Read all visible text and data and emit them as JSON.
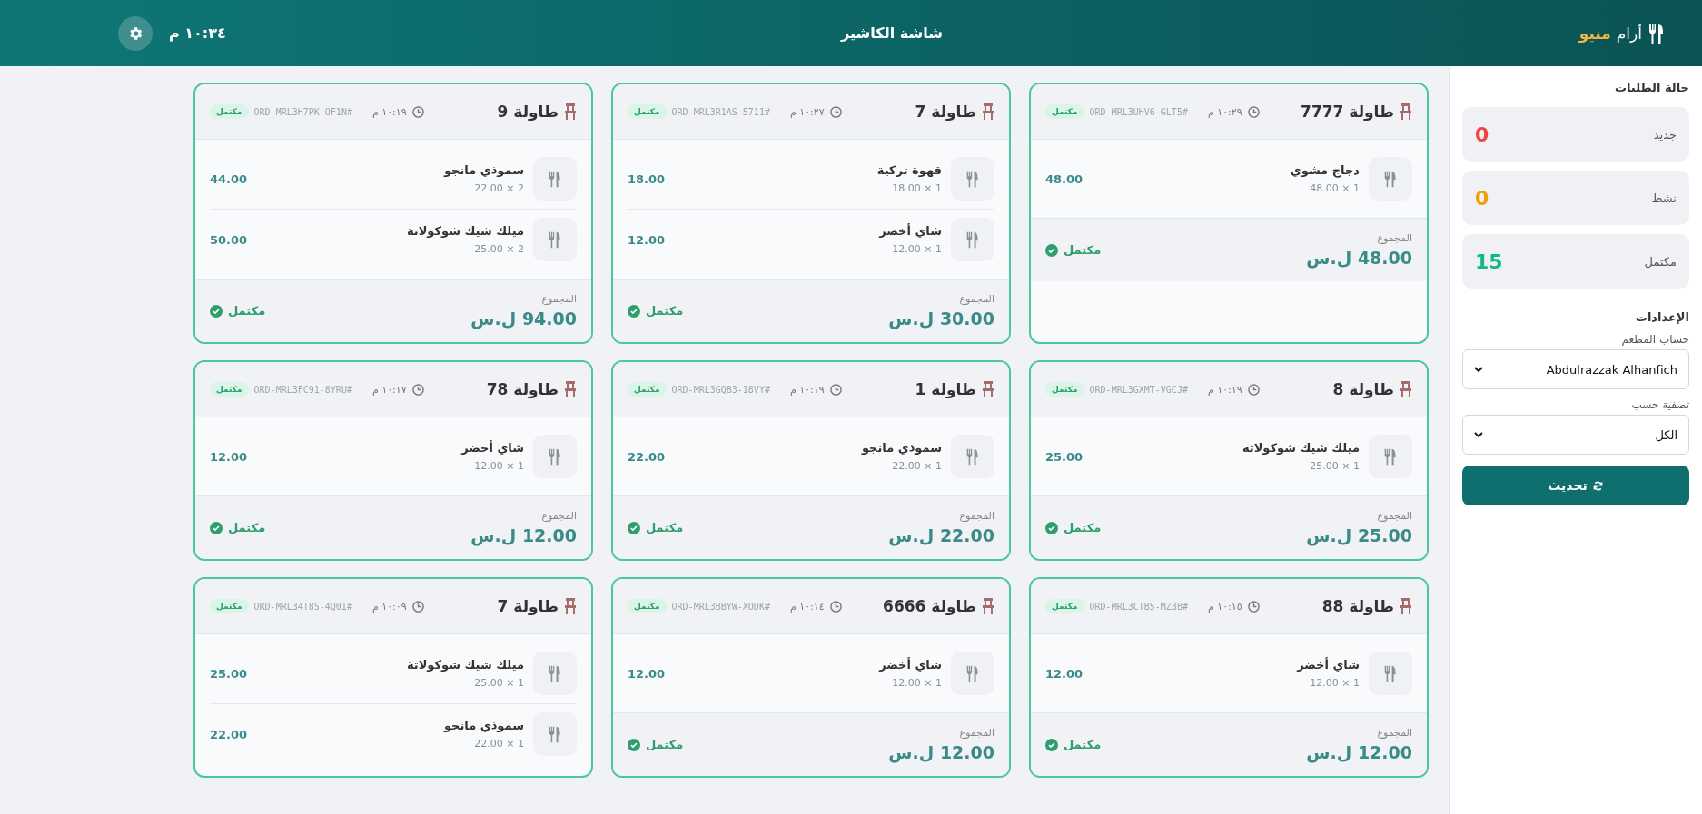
{
  "header": {
    "brand_name": "أرام",
    "brand_accent": "منيو",
    "title": "شاشة الكاشير",
    "clock": "١٠:٣٤ م"
  },
  "sidebar": {
    "status_title": "حالة الطلبات",
    "stats": [
      {
        "label": "جديد",
        "count": "0",
        "color": "#ef4444"
      },
      {
        "label": "نشط",
        "count": "0",
        "color": "#f59e0b"
      },
      {
        "label": "مكتمل",
        "count": "15",
        "color": "#10b981"
      }
    ],
    "settings_title": "الإعدادات",
    "account_label": "حساب المطعم",
    "account_value": "Abdulrazzak Alhanfich",
    "filter_label": "تصفية حسب",
    "filter_value": "الكل",
    "refresh_button": "تحديث"
  },
  "orders": [
    {
      "table": "طاولة 7777",
      "time": "١٠:٢٩ م",
      "id": "#ORD-MRL3UHV6-GLT5",
      "kind": "completed",
      "status_label": "مكتمل",
      "items": [
        {
          "name": "دجاج مشوي",
          "qty": "1 × 48.00",
          "price": "48.00"
        }
      ],
      "total_label": "المجموع",
      "total": "48.00 ل.س",
      "footer_status": "مكتمل"
    },
    {
      "table": "طاولة 7",
      "time": "١٠:٢٧ م",
      "id": "#ORD-MRL3R1AS-5711",
      "kind": "completed",
      "status_label": "مكتمل",
      "items": [
        {
          "name": "قهوة تركية",
          "qty": "1 × 18.00",
          "price": "18.00"
        },
        {
          "name": "شاي أخضر",
          "qty": "1 × 12.00",
          "price": "12.00"
        }
      ],
      "total_label": "المجموع",
      "total": "30.00 ل.س",
      "footer_status": "مكتمل"
    },
    {
      "table": "طاولة 9",
      "time": "١٠:١٩ م",
      "id": "#ORD-MRL3H7PK-OF1N",
      "kind": "completed",
      "status_label": "مكتمل",
      "items": [
        {
          "name": "سموذي مانجو",
          "qty": "2 × 22.00",
          "price": "44.00"
        },
        {
          "name": "ميلك شيك شوكولاتة",
          "qty": "2 × 25.00",
          "price": "50.00"
        }
      ],
      "total_label": "المجموع",
      "total": "94.00 ل.س",
      "footer_status": "مكتمل"
    },
    {
      "table": "طاولة 8",
      "time": "١٠:١٩ م",
      "id": "#ORD-MRL3GXMT-VGCJ",
      "kind": "completed",
      "status_label": "مكتمل",
      "items": [
        {
          "name": "ميلك شيك شوكولاتة",
          "qty": "1 × 25.00",
          "price": "25.00"
        }
      ],
      "total_label": "المجموع",
      "total": "25.00 ل.س",
      "footer_status": "مكتمل"
    },
    {
      "table": "طاولة 1",
      "time": "١٠:١٩ م",
      "id": "#ORD-MRL3GQB3-18VY",
      "kind": "completed",
      "status_label": "مكتمل",
      "items": [
        {
          "name": "سموذي مانجو",
          "qty": "1 × 22.00",
          "price": "22.00"
        }
      ],
      "total_label": "المجموع",
      "total": "22.00 ل.س",
      "footer_status": "مكتمل"
    },
    {
      "table": "طاولة 78",
      "time": "١٠:١٧ م",
      "id": "#ORD-MRL3FC91-8YRU",
      "kind": "completed",
      "status_label": "مكتمل",
      "items": [
        {
          "name": "شاي أخضر",
          "qty": "1 × 12.00",
          "price": "12.00"
        }
      ],
      "total_label": "المجموع",
      "total": "12.00 ل.س",
      "footer_status": "مكتمل"
    },
    {
      "table": "طاولة 88",
      "time": "١٠:١٥ م",
      "id": "#ORD-MRL3CTB5-MZ3B",
      "kind": "completed",
      "status_label": "مكتمل",
      "items": [
        {
          "name": "شاي أخضر",
          "qty": "1 × 12.00",
          "price": "12.00"
        }
      ],
      "total_label": "المجموع",
      "total": "12.00 ل.س",
      "footer_status": "مكتمل"
    },
    {
      "table": "طاولة 6666",
      "time": "١٠:١٤ م",
      "id": "#ORD-MRL3BBYW-XODK",
      "kind": "completed",
      "status_label": "مكتمل",
      "items": [
        {
          "name": "شاي أخضر",
          "qty": "1 × 12.00",
          "price": "12.00"
        }
      ],
      "total_label": "المجموع",
      "total": "12.00 ل.س",
      "footer_status": "مكتمل"
    },
    {
      "table": "طاولة 7",
      "time": "١٠:٠٩ م",
      "id": "#ORD-MRL34T8S-4Q0I",
      "kind": "completed",
      "status_label": "مكتمل",
      "items": [
        {
          "name": "ميلك شيك شوكولاتة",
          "qty": "1 × 25.00",
          "price": "25.00"
        },
        {
          "name": "سموذي مانجو",
          "qty": "1 × 22.00",
          "price": "22.00"
        }
      ]
    }
  ]
}
